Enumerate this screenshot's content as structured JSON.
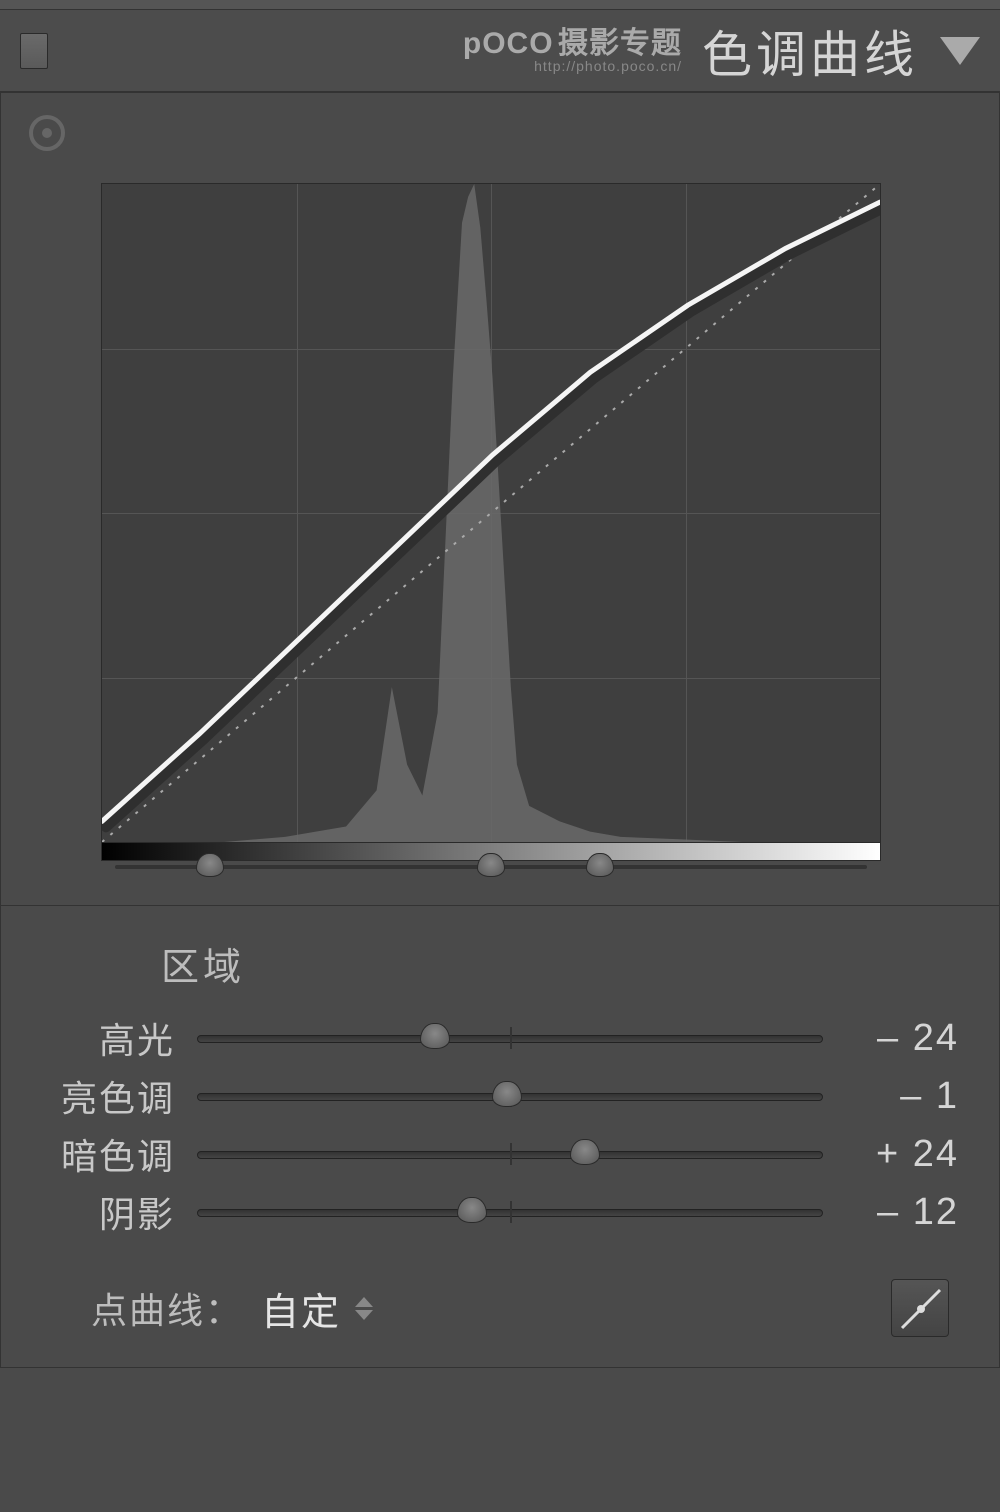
{
  "header": {
    "watermark_brand": "pOCO",
    "watermark_tag": "摄影专题",
    "watermark_url": "http://photo.poco.cn/",
    "title": "色调曲线"
  },
  "regions": {
    "section_label": "区域",
    "splits_pct": [
      14,
      50,
      64
    ]
  },
  "sliders": [
    {
      "label": "高光",
      "value": -24,
      "display": "– 24"
    },
    {
      "label": "亮色调",
      "value": -1,
      "display": "– 1"
    },
    {
      "label": "暗色调",
      "value": 24,
      "display": "+ 24"
    },
    {
      "label": "阴影",
      "value": -12,
      "display": "– 12"
    }
  ],
  "point_curve": {
    "label": "点曲线：",
    "value": "自定"
  },
  "chart_data": {
    "type": "line",
    "title": "色调曲线",
    "xlabel": "",
    "ylabel": "",
    "xlim": [
      0,
      255
    ],
    "ylim": [
      0,
      255
    ],
    "histogram_x": [
      0,
      20,
      40,
      60,
      80,
      90,
      95,
      100,
      105,
      110,
      115,
      118,
      120,
      122,
      124,
      126,
      128,
      130,
      132,
      134,
      136,
      140,
      150,
      160,
      170,
      190,
      210,
      230,
      255
    ],
    "histogram_y": [
      0,
      0,
      0,
      2,
      6,
      20,
      60,
      30,
      18,
      50,
      180,
      240,
      250,
      255,
      238,
      210,
      180,
      140,
      100,
      60,
      30,
      14,
      8,
      4,
      2,
      1,
      0,
      0,
      0
    ],
    "series": [
      {
        "name": "baseline",
        "x": [
          0,
          255
        ],
        "y": [
          0,
          255
        ]
      },
      {
        "name": "curve",
        "x": [
          0,
          32,
          64,
          96,
          128,
          160,
          192,
          224,
          255
        ],
        "y": [
          8,
          42,
          78,
          114,
          150,
          182,
          208,
          230,
          248
        ]
      }
    ],
    "region_splits": [
      36,
      128,
      163
    ]
  }
}
